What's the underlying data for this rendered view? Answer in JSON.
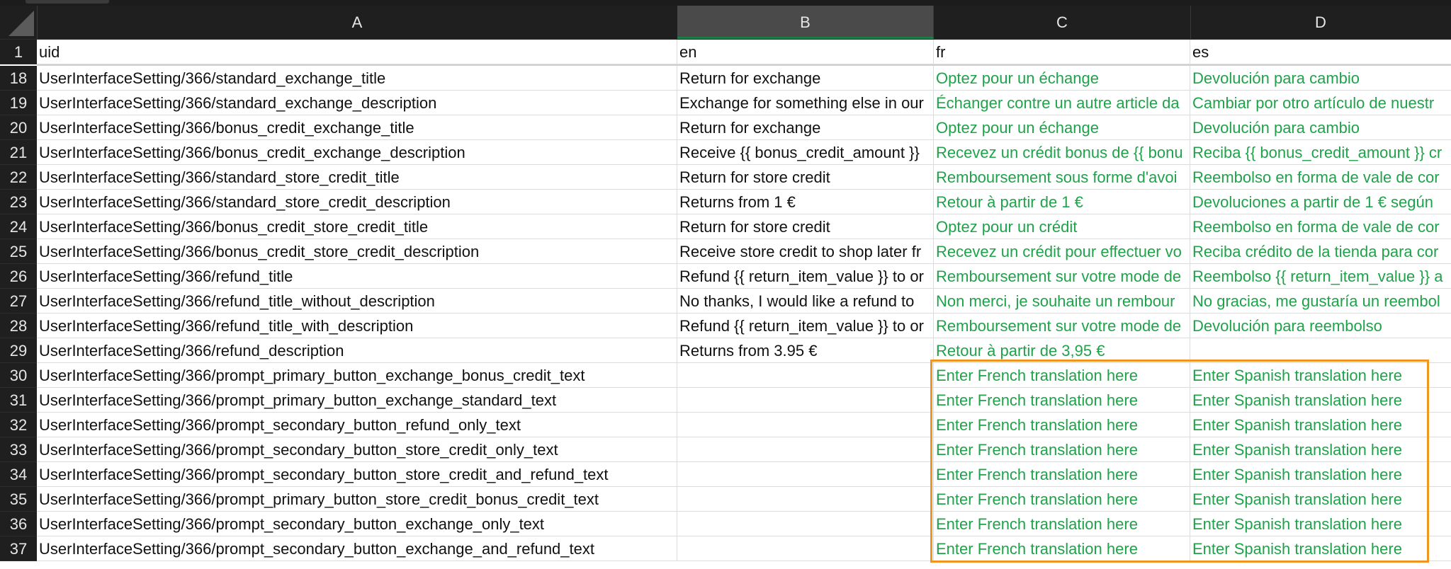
{
  "columns": [
    "A",
    "B",
    "C",
    "D"
  ],
  "selected_column": "B",
  "highlight_color": "#f0951f",
  "text_color_translations": "#1fa24a",
  "rows": [
    {
      "n": "1",
      "a": "uid",
      "b": "en",
      "c": "fr",
      "d": "es",
      "header": true
    },
    {
      "n": "18",
      "a": "UserInterfaceSetting/366/standard_exchange_title",
      "b": "Return for exchange",
      "c": "Optez pour un échange",
      "d": "Devolución para cambio"
    },
    {
      "n": "19",
      "a": "UserInterfaceSetting/366/standard_exchange_description",
      "b": "Exchange for something else in our",
      "c": "Échanger contre un autre article da",
      "d": "Cambiar por otro artículo de nuestr"
    },
    {
      "n": "20",
      "a": "UserInterfaceSetting/366/bonus_credit_exchange_title",
      "b": "Return for exchange",
      "c": "Optez pour un échange",
      "d": "Devolución para cambio"
    },
    {
      "n": "21",
      "a": "UserInterfaceSetting/366/bonus_credit_exchange_description",
      "b": "Receive {{ bonus_credit_amount }}",
      "c": "Recevez un crédit bonus de {{ bonu",
      "d": "Reciba {{ bonus_credit_amount }} cr"
    },
    {
      "n": "22",
      "a": "UserInterfaceSetting/366/standard_store_credit_title",
      "b": "Return for store credit",
      "c": "Remboursement sous forme d'avoi",
      "d": "Reembolso en forma de vale de cor"
    },
    {
      "n": "23",
      "a": "UserInterfaceSetting/366/standard_store_credit_description",
      "b": "Returns from 1 €",
      "c": "Retour à partir de 1 €",
      "d": "Devoluciones a partir de 1 € según"
    },
    {
      "n": "24",
      "a": "UserInterfaceSetting/366/bonus_credit_store_credit_title",
      "b": "Return for store credit",
      "c": "Optez pour un crédit",
      "d": "Reembolso en forma de vale de cor"
    },
    {
      "n": "25",
      "a": "UserInterfaceSetting/366/bonus_credit_store_credit_description",
      "b": "Receive store credit to shop later fr",
      "c": "Recevez un crédit pour effectuer vo",
      "d": "Reciba crédito de la tienda para cor"
    },
    {
      "n": "26",
      "a": "UserInterfaceSetting/366/refund_title",
      "b": "Refund {{ return_item_value }} to or",
      "c": "Remboursement sur votre mode de",
      "d": "Reembolso {{ return_item_value }} a"
    },
    {
      "n": "27",
      "a": "UserInterfaceSetting/366/refund_title_without_description",
      "b": "No thanks, I would like a refund to",
      "c": "Non merci, je souhaite un rembour",
      "d": "No gracias, me gustaría un reembol"
    },
    {
      "n": "28",
      "a": "UserInterfaceSetting/366/refund_title_with_description",
      "b": "Refund {{ return_item_value }} to or",
      "c": "Remboursement sur votre mode de",
      "d": "Devolución para reembolso"
    },
    {
      "n": "29",
      "a": "UserInterfaceSetting/366/refund_description",
      "b": "Returns from 3.95 €",
      "c": "Retour à partir de 3,95 €",
      "d": ""
    },
    {
      "n": "30",
      "a": "UserInterfaceSetting/366/prompt_primary_button_exchange_bonus_credit_text",
      "b": "",
      "c": "Enter French translation here",
      "d": "Enter Spanish translation here"
    },
    {
      "n": "31",
      "a": "UserInterfaceSetting/366/prompt_primary_button_exchange_standard_text",
      "b": "",
      "c": "Enter French translation here",
      "d": "Enter Spanish translation here"
    },
    {
      "n": "32",
      "a": "UserInterfaceSetting/366/prompt_secondary_button_refund_only_text",
      "b": "",
      "c": "Enter French translation here",
      "d": "Enter Spanish translation here"
    },
    {
      "n": "33",
      "a": "UserInterfaceSetting/366/prompt_secondary_button_store_credit_only_text",
      "b": "",
      "c": "Enter French translation here",
      "d": "Enter Spanish translation here"
    },
    {
      "n": "34",
      "a": "UserInterfaceSetting/366/prompt_secondary_button_store_credit_and_refund_text",
      "b": "",
      "c": "Enter French translation here",
      "d": "Enter Spanish translation here"
    },
    {
      "n": "35",
      "a": "UserInterfaceSetting/366/prompt_primary_button_store_credit_bonus_credit_text",
      "b": "",
      "c": "Enter French translation here",
      "d": "Enter Spanish translation here"
    },
    {
      "n": "36",
      "a": "UserInterfaceSetting/366/prompt_secondary_button_exchange_only_text",
      "b": "",
      "c": "Enter French translation here",
      "d": "Enter Spanish translation here"
    },
    {
      "n": "37",
      "a": "UserInterfaceSetting/366/prompt_secondary_button_exchange_and_refund_text",
      "b": "",
      "c": "Enter French translation here",
      "d": "Enter Spanish translation here"
    }
  ]
}
